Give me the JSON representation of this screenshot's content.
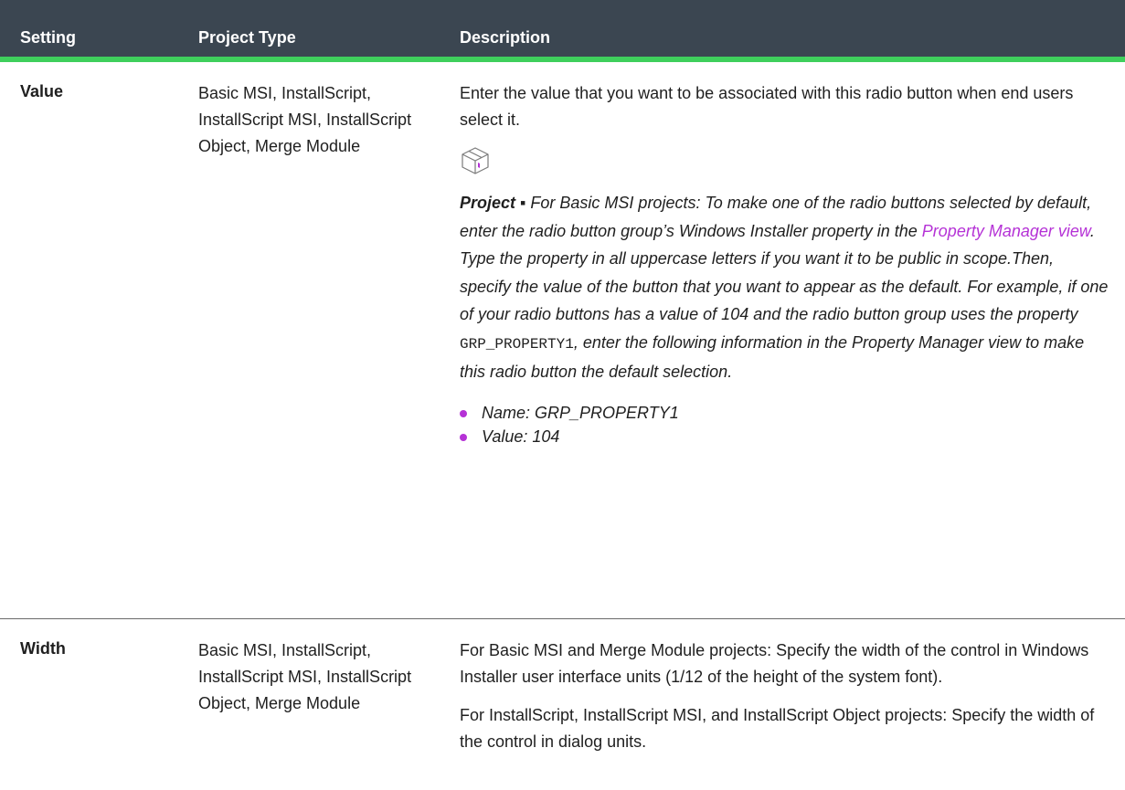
{
  "columns": [
    "Setting",
    "Project Type",
    "Description"
  ],
  "rows": [
    {
      "setting": "Value",
      "project_type": "Basic MSI, InstallScript, InstallScript MSI, InstallScript Object, Merge Module",
      "description_intro": "Enter the value that you want to be associated with this radio button when end users select it.",
      "note": {
        "icon": "package-box-icon",
        "label": "Project ▪",
        "text_a": " For Basic MSI projects: To make one of the radio buttons selected by default, enter the radio button group’s Windows Installer property in the ",
        "link_text": "Property Manager view",
        "text_b": ". Type the property in all uppercase letters if you want it to be public in scope.Then, specify the value of the button that you want to appear as the default. For example, if one of your radio buttons has a value of 104 and the radio button group uses the property ",
        "code": "GRP_PROPERTY1",
        "text_c": ", enter the following information in the Property Manager view to make this radio button the default selection.",
        "bullets": [
          "Name: GRP_PROPERTY1",
          "Value: 104"
        ]
      }
    },
    {
      "setting": "Width",
      "project_type": "Basic MSI, InstallScript, InstallScript MSI, InstallScript Object, Merge Module",
      "desc_p1": "For Basic MSI and Merge Module projects: Specify the width of the control in Windows Installer user interface units (1/12 of the height of the system font).",
      "desc_p2": "For InstallScript, InstallScript MSI, and InstallScript Object projects: Specify the width of the control in dialog units."
    }
  ],
  "colors": {
    "header_bg": "#3b4651",
    "header_accent": "#3fcf5c",
    "link": "#b532d6"
  }
}
